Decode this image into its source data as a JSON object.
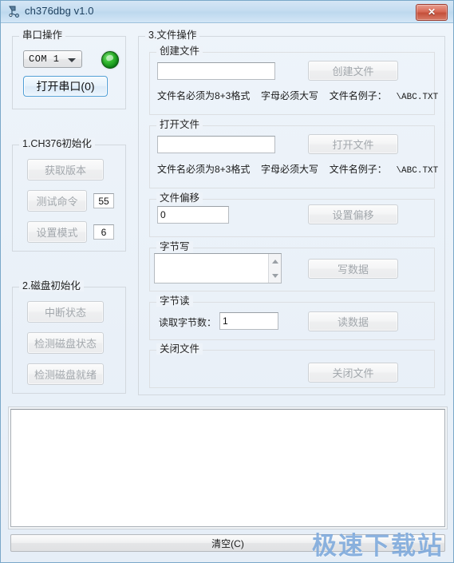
{
  "window": {
    "title": "ch376dbg v1.0",
    "icon": "app-icon",
    "close_label": "✕"
  },
  "serial_group": {
    "title": "串口操作",
    "com_value": "COM 1",
    "led_state": "connected",
    "open_button": "打开串口(0)"
  },
  "init_group": {
    "title": "1.CH376初始化",
    "get_version_button": "获取版本",
    "test_cmd_button": "测试命令",
    "test_cmd_value": "55",
    "set_mode_button": "设置模式",
    "set_mode_value": "6"
  },
  "disk_group": {
    "title": "2.磁盘初始化",
    "interrupt_status_button": "中断状态",
    "check_disk_status_button": "检测磁盘状态",
    "check_disk_ready_button": "检测磁盘就绪"
  },
  "file_group": {
    "title": "3.文件操作",
    "create": {
      "title": "创建文件",
      "input_value": "",
      "button": "创建文件",
      "hint_a": "文件名必须为8+3格式",
      "hint_b": "字母必须大写",
      "hint_c": "文件名例子：",
      "hint_example": "\\ABC.TXT"
    },
    "open": {
      "title": "打开文件",
      "input_value": "",
      "button": "打开文件",
      "hint_a": "文件名必须为8+3格式",
      "hint_b": "字母必须大写",
      "hint_c": "文件名例子：",
      "hint_example": "\\ABC.TXT"
    },
    "offset": {
      "title": "文件偏移",
      "input_value": "0",
      "button": "设置偏移"
    },
    "write": {
      "title": "字节写",
      "input_value": "",
      "button": "写数据"
    },
    "read": {
      "title": "字节读",
      "label": "读取字节数：",
      "input_value": "1",
      "button": "读数据"
    },
    "close": {
      "title": "关闭文件",
      "button": "关闭文件"
    }
  },
  "log": {
    "content": ""
  },
  "footer": {
    "clear_button": "清空(C)",
    "watermark": "极速下载站"
  },
  "colors": {
    "accent": "#4f9ed6",
    "led_green": "#2fb52c",
    "close_red": "#c4503b",
    "watermark_blue": "#6096d4"
  }
}
